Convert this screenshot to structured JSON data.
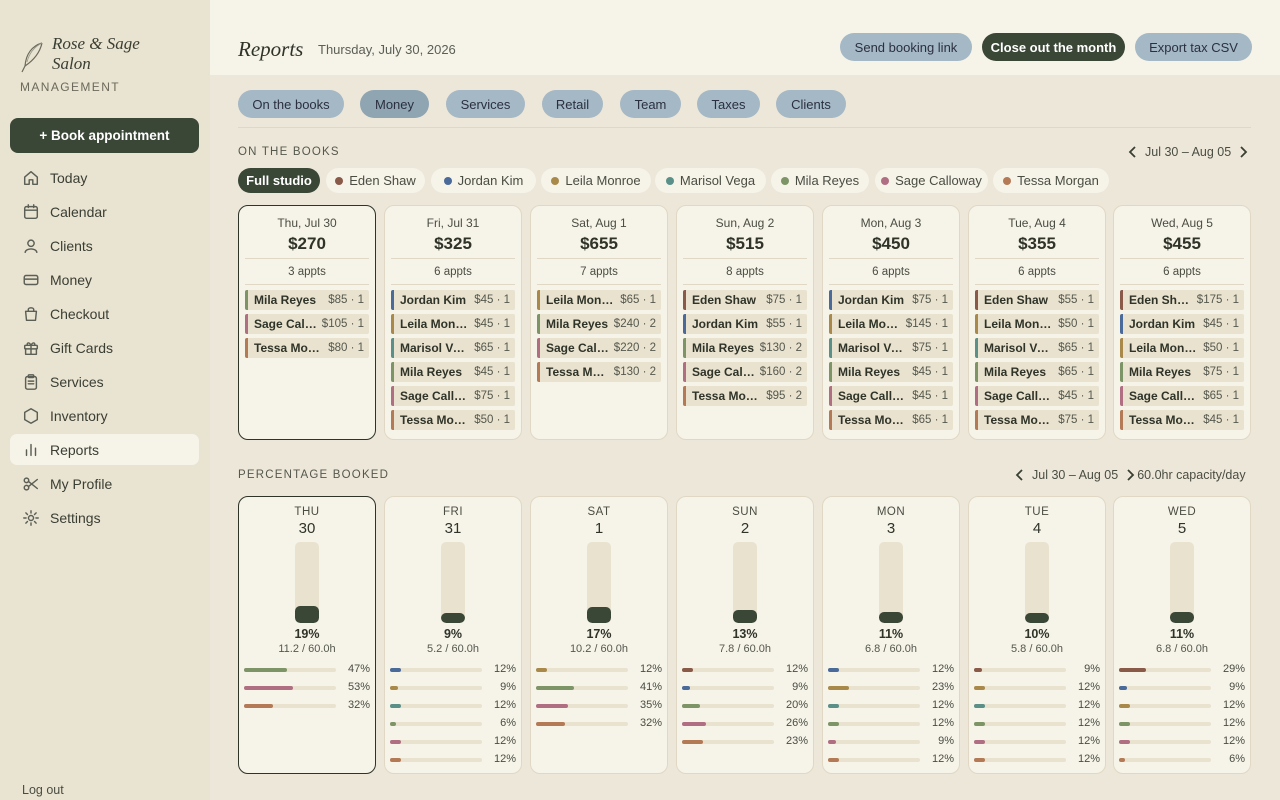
{
  "brand": {
    "name": "Rose & Sage Salon",
    "subtitle": "MANAGEMENT"
  },
  "sidebar": {
    "book_label": "+ Book appointment",
    "items": [
      {
        "label": "Today",
        "icon": "home-icon"
      },
      {
        "label": "Calendar",
        "icon": "calendar-icon"
      },
      {
        "label": "Clients",
        "icon": "user-icon"
      },
      {
        "label": "Money",
        "icon": "card-icon"
      },
      {
        "label": "Checkout",
        "icon": "bag-icon"
      },
      {
        "label": "Gift Cards",
        "icon": "gift-icon"
      },
      {
        "label": "Services",
        "icon": "clipboard-icon"
      },
      {
        "label": "Inventory",
        "icon": "hexagon-icon"
      },
      {
        "label": "Reports",
        "icon": "bar-chart-icon",
        "active": true
      },
      {
        "label": "My Profile",
        "icon": "scissors-icon"
      },
      {
        "label": "Settings",
        "icon": "gear-icon"
      }
    ],
    "logout_label": "Log out"
  },
  "header": {
    "title": "Reports",
    "date": "Thursday, July 30, 2026",
    "buttons": {
      "send": "Send booking link",
      "close": "Close out the month",
      "export": "Export tax CSV"
    }
  },
  "tabs": [
    "On the books",
    "Money",
    "Services",
    "Retail",
    "Team",
    "Taxes",
    "Clients"
  ],
  "active_tab": "Money",
  "on_books": {
    "title": "ON THE BOOKS",
    "range": "Jul 30 – Aug 05",
    "filters": [
      {
        "label": "Full studio"
      },
      {
        "label": "Eden Shaw",
        "color": "#8a5a48"
      },
      {
        "label": "Jordan Kim",
        "color": "#4a6a9a"
      },
      {
        "label": "Leila Monroe",
        "color": "#a8894a"
      },
      {
        "label": "Marisol Vega",
        "color": "#5a9088"
      },
      {
        "label": "Mila Reyes",
        "color": "#7d9466"
      },
      {
        "label": "Sage Calloway",
        "color": "#b06e82"
      },
      {
        "label": "Tessa Morgan",
        "color": "#b47a55"
      }
    ],
    "days": [
      {
        "day": "Thu, Jul 30",
        "amount": "$270",
        "appts": "3 appts",
        "items": [
          {
            "name": "Mila Reyes",
            "val": "$85 · 1",
            "color": "#7d9466"
          },
          {
            "name": "Sage Calloway",
            "val": "$105 · 1",
            "color": "#b06e82"
          },
          {
            "name": "Tessa Morgan",
            "val": "$80 · 1",
            "color": "#b47a55"
          }
        ]
      },
      {
        "day": "Fri, Jul 31",
        "amount": "$325",
        "appts": "6 appts",
        "items": [
          {
            "name": "Jordan Kim",
            "val": "$45 · 1",
            "color": "#4a6a9a"
          },
          {
            "name": "Leila Monroe",
            "val": "$45 · 1",
            "color": "#a8894a"
          },
          {
            "name": "Marisol Vega",
            "val": "$65 · 1",
            "color": "#5a9088"
          },
          {
            "name": "Mila Reyes",
            "val": "$45 · 1",
            "color": "#7d9466"
          },
          {
            "name": "Sage Calloway",
            "val": "$75 · 1",
            "color": "#b06e82"
          },
          {
            "name": "Tessa Morgan",
            "val": "$50 · 1",
            "color": "#b47a55"
          }
        ]
      },
      {
        "day": "Sat, Aug 1",
        "amount": "$655",
        "appts": "7 appts",
        "items": [
          {
            "name": "Leila Monroe",
            "val": "$65 · 1",
            "color": "#a8894a"
          },
          {
            "name": "Mila Reyes",
            "val": "$240 · 2",
            "color": "#7d9466"
          },
          {
            "name": "Sage Calloway",
            "val": "$220 · 2",
            "color": "#b06e82"
          },
          {
            "name": "Tessa Morgan",
            "val": "$130 · 2",
            "color": "#b47a55"
          }
        ]
      },
      {
        "day": "Sun, Aug 2",
        "amount": "$515",
        "appts": "8 appts",
        "items": [
          {
            "name": "Eden Shaw",
            "val": "$75 · 1",
            "color": "#8a5a48"
          },
          {
            "name": "Jordan Kim",
            "val": "$55 · 1",
            "color": "#4a6a9a"
          },
          {
            "name": "Mila Reyes",
            "val": "$130 · 2",
            "color": "#7d9466"
          },
          {
            "name": "Sage Calloway",
            "val": "$160 · 2",
            "color": "#b06e82"
          },
          {
            "name": "Tessa Morgan",
            "val": "$95 · 2",
            "color": "#b47a55"
          }
        ]
      },
      {
        "day": "Mon, Aug 3",
        "amount": "$450",
        "appts": "6 appts",
        "items": [
          {
            "name": "Jordan Kim",
            "val": "$75 · 1",
            "color": "#4a6a9a"
          },
          {
            "name": "Leila Monroe",
            "val": "$145 · 1",
            "color": "#a8894a"
          },
          {
            "name": "Marisol Vega",
            "val": "$75 · 1",
            "color": "#5a9088"
          },
          {
            "name": "Mila Reyes",
            "val": "$45 · 1",
            "color": "#7d9466"
          },
          {
            "name": "Sage Calloway",
            "val": "$45 · 1",
            "color": "#b06e82"
          },
          {
            "name": "Tessa Morgan",
            "val": "$65 · 1",
            "color": "#b47a55"
          }
        ]
      },
      {
        "day": "Tue, Aug 4",
        "amount": "$355",
        "appts": "6 appts",
        "items": [
          {
            "name": "Eden Shaw",
            "val": "$55 · 1",
            "color": "#8a5a48"
          },
          {
            "name": "Leila Monroe",
            "val": "$50 · 1",
            "color": "#a8894a"
          },
          {
            "name": "Marisol Vega",
            "val": "$65 · 1",
            "color": "#5a9088"
          },
          {
            "name": "Mila Reyes",
            "val": "$65 · 1",
            "color": "#7d9466"
          },
          {
            "name": "Sage Calloway",
            "val": "$45 · 1",
            "color": "#b06e82"
          },
          {
            "name": "Tessa Morgan",
            "val": "$75 · 1",
            "color": "#b47a55"
          }
        ]
      },
      {
        "day": "Wed, Aug 5",
        "amount": "$455",
        "appts": "6 appts",
        "items": [
          {
            "name": "Eden Shaw",
            "val": "$175 · 1",
            "color": "#8a5a48"
          },
          {
            "name": "Jordan Kim",
            "val": "$45 · 1",
            "color": "#4a6a9a"
          },
          {
            "name": "Leila Monroe",
            "val": "$50 · 1",
            "color": "#a8894a"
          },
          {
            "name": "Mila Reyes",
            "val": "$75 · 1",
            "color": "#7d9466"
          },
          {
            "name": "Sage Calloway",
            "val": "$65 · 1",
            "color": "#b06e82"
          },
          {
            "name": "Tessa Morgan",
            "val": "$45 · 1",
            "color": "#b47a55"
          }
        ]
      }
    ]
  },
  "pct_booked": {
    "title": "PERCENTAGE BOOKED",
    "range": "Jul 30 – Aug 05",
    "capacity": "60.0hr capacity/day",
    "days": [
      {
        "dow": "THU",
        "num": "30",
        "pct": 19,
        "pct_label": "19%",
        "hours": "11.2 / 60.0h",
        "staff": [
          {
            "pct": 47,
            "label": "47%",
            "color": "#7d9466"
          },
          {
            "pct": 53,
            "label": "53%",
            "color": "#b06e82"
          },
          {
            "pct": 32,
            "label": "32%",
            "color": "#b47a55"
          }
        ]
      },
      {
        "dow": "FRI",
        "num": "31",
        "pct": 9,
        "pct_label": "9%",
        "hours": "5.2 / 60.0h",
        "staff": [
          {
            "pct": 12,
            "label": "12%",
            "color": "#4a6a9a"
          },
          {
            "pct": 9,
            "label": "9%",
            "color": "#a8894a"
          },
          {
            "pct": 12,
            "label": "12%",
            "color": "#5a9088"
          },
          {
            "pct": 6,
            "label": "6%",
            "color": "#7d9466"
          },
          {
            "pct": 12,
            "label": "12%",
            "color": "#b06e82"
          },
          {
            "pct": 12,
            "label": "12%",
            "color": "#b47a55"
          }
        ]
      },
      {
        "dow": "SAT",
        "num": "1",
        "pct": 17,
        "pct_label": "17%",
        "hours": "10.2 / 60.0h",
        "staff": [
          {
            "pct": 12,
            "label": "12%",
            "color": "#a8894a"
          },
          {
            "pct": 41,
            "label": "41%",
            "color": "#7d9466"
          },
          {
            "pct": 35,
            "label": "35%",
            "color": "#b06e82"
          },
          {
            "pct": 32,
            "label": "32%",
            "color": "#b47a55"
          }
        ]
      },
      {
        "dow": "SUN",
        "num": "2",
        "pct": 13,
        "pct_label": "13%",
        "hours": "7.8 / 60.0h",
        "staff": [
          {
            "pct": 12,
            "label": "12%",
            "color": "#8a5a48"
          },
          {
            "pct": 9,
            "label": "9%",
            "color": "#4a6a9a"
          },
          {
            "pct": 20,
            "label": "20%",
            "color": "#7d9466"
          },
          {
            "pct": 26,
            "label": "26%",
            "color": "#b06e82"
          },
          {
            "pct": 23,
            "label": "23%",
            "color": "#b47a55"
          }
        ]
      },
      {
        "dow": "MON",
        "num": "3",
        "pct": 11,
        "pct_label": "11%",
        "hours": "6.8 / 60.0h",
        "staff": [
          {
            "pct": 12,
            "label": "12%",
            "color": "#4a6a9a"
          },
          {
            "pct": 23,
            "label": "23%",
            "color": "#a8894a"
          },
          {
            "pct": 12,
            "label": "12%",
            "color": "#5a9088"
          },
          {
            "pct": 12,
            "label": "12%",
            "color": "#7d9466"
          },
          {
            "pct": 9,
            "label": "9%",
            "color": "#b06e82"
          },
          {
            "pct": 12,
            "label": "12%",
            "color": "#b47a55"
          }
        ]
      },
      {
        "dow": "TUE",
        "num": "4",
        "pct": 10,
        "pct_label": "10%",
        "hours": "5.8 / 60.0h",
        "staff": [
          {
            "pct": 9,
            "label": "9%",
            "color": "#8a5a48"
          },
          {
            "pct": 12,
            "label": "12%",
            "color": "#a8894a"
          },
          {
            "pct": 12,
            "label": "12%",
            "color": "#5a9088"
          },
          {
            "pct": 12,
            "label": "12%",
            "color": "#7d9466"
          },
          {
            "pct": 12,
            "label": "12%",
            "color": "#b06e82"
          },
          {
            "pct": 12,
            "label": "12%",
            "color": "#b47a55"
          }
        ]
      },
      {
        "dow": "WED",
        "num": "5",
        "pct": 11,
        "pct_label": "11%",
        "hours": "6.8 / 60.0h",
        "staff": [
          {
            "pct": 29,
            "label": "29%",
            "color": "#8a5a48"
          },
          {
            "pct": 9,
            "label": "9%",
            "color": "#4a6a9a"
          },
          {
            "pct": 12,
            "label": "12%",
            "color": "#a8894a"
          },
          {
            "pct": 12,
            "label": "12%",
            "color": "#7d9466"
          },
          {
            "pct": 12,
            "label": "12%",
            "color": "#b06e82"
          },
          {
            "pct": 6,
            "label": "6%",
            "color": "#b47a55"
          }
        ]
      }
    ]
  }
}
